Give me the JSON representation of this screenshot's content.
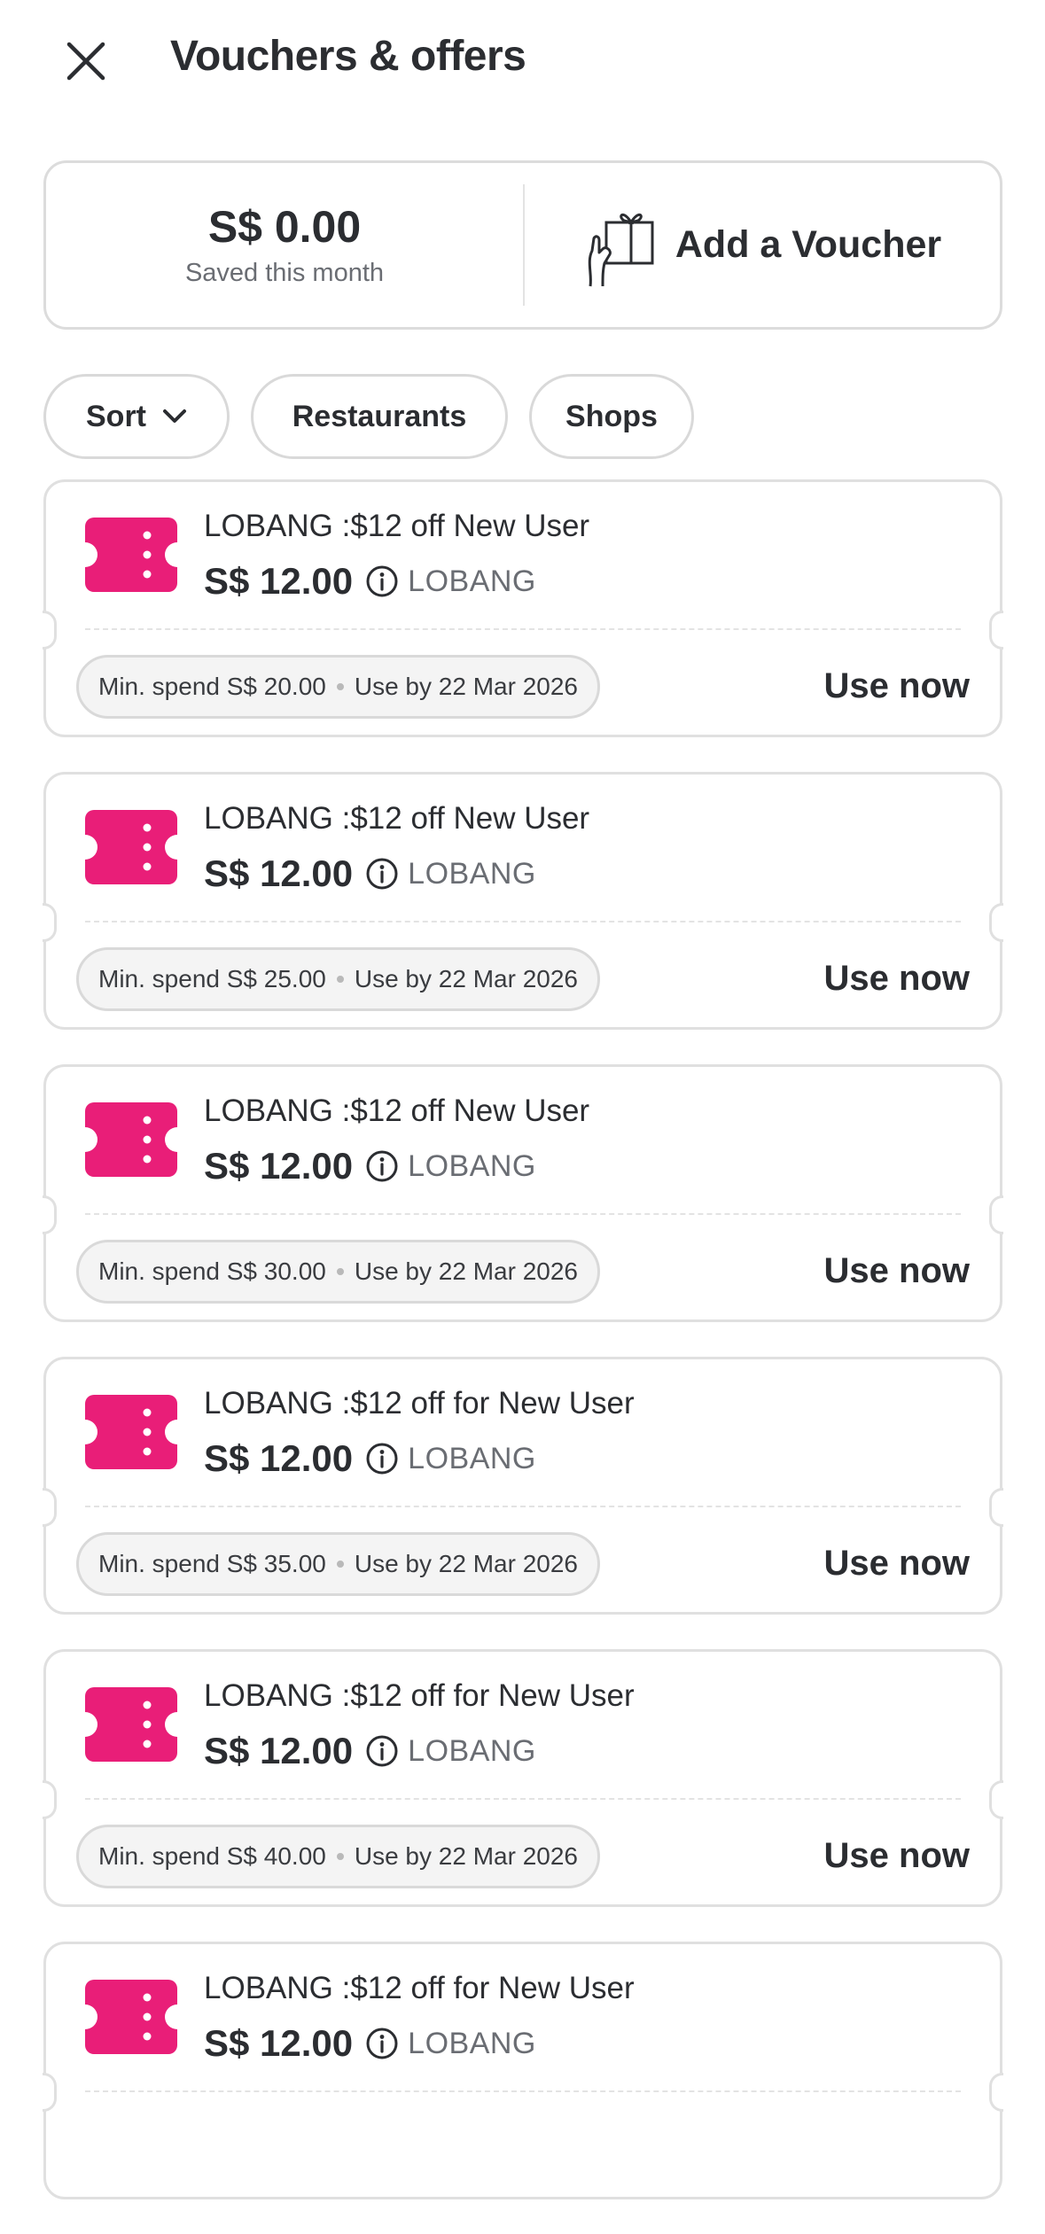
{
  "header": {
    "title": "Vouchers & offers",
    "close_icon": "close-icon"
  },
  "summary": {
    "saved_amount": "S$ 0.00",
    "saved_caption": "Saved this month",
    "add_voucher_label": "Add a Voucher",
    "add_voucher_icon": "gift-hand-icon"
  },
  "filters": {
    "sort_label": "Sort",
    "restaurants_label": "Restaurants",
    "shops_label": "Shops"
  },
  "colors": {
    "accent": "#e91e78",
    "text": "#2b2d31",
    "muted": "#6a6d73"
  },
  "vouchers": [
    {
      "title": "LOBANG :$12 off New User",
      "amount": "S$ 12.00",
      "brand": "LOBANG",
      "min_spend": "Min. spend S$ 20.00",
      "use_by": "Use by 22 Mar 2026",
      "action": "Use now"
    },
    {
      "title": "LOBANG :$12 off New User",
      "amount": "S$ 12.00",
      "brand": "LOBANG",
      "min_spend": "Min. spend S$ 25.00",
      "use_by": "Use by 22 Mar 2026",
      "action": "Use now"
    },
    {
      "title": "LOBANG :$12 off New User",
      "amount": "S$ 12.00",
      "brand": "LOBANG",
      "min_spend": "Min. spend S$ 30.00",
      "use_by": "Use by 22 Mar 2026",
      "action": "Use now"
    },
    {
      "title": "LOBANG :$12 off for New User",
      "amount": "S$ 12.00",
      "brand": "LOBANG",
      "min_spend": "Min. spend S$ 35.00",
      "use_by": "Use by 22 Mar 2026",
      "action": "Use now"
    },
    {
      "title": "LOBANG :$12 off for New User",
      "amount": "S$ 12.00",
      "brand": "LOBANG",
      "min_spend": "Min. spend S$ 40.00",
      "use_by": "Use by 22 Mar 2026",
      "action": "Use now"
    },
    {
      "title": "LOBANG :$12 off for New User",
      "amount": "S$ 12.00",
      "brand": "LOBANG",
      "min_spend": "",
      "use_by": "",
      "action": ""
    }
  ]
}
